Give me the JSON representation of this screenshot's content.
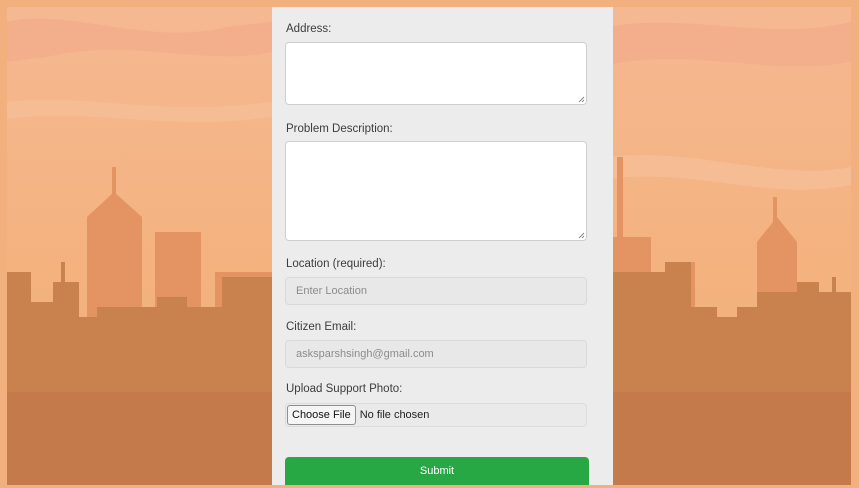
{
  "form": {
    "address_label": "Address:",
    "address_value": "",
    "problem_label": "Problem Description:",
    "problem_value": "",
    "location_label": "Location (required):",
    "location_placeholder": "Enter Location",
    "email_label": "Citizen Email:",
    "email_value": "asksparshsingh@gmail.com",
    "photo_label": "Upload Support Photo:",
    "choose_file_label": "Choose File",
    "no_file_text": "No file chosen",
    "submit_label": "Submit"
  },
  "colors": {
    "sky_top": "#f4b48c",
    "sky_bottom": "#f2b27a",
    "buildings_far": "#e79a67",
    "buildings_near": "#c8834f",
    "submit": "#28a745",
    "card": "#ececec"
  },
  "icons": [
    "resize-grip-icon"
  ]
}
